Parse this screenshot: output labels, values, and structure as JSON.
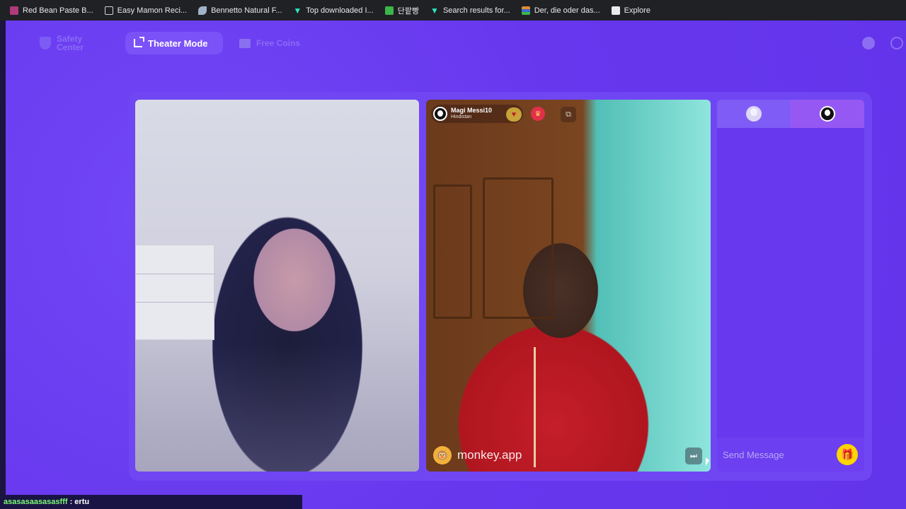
{
  "bookmarks": [
    {
      "label": "Red Bean Paste B...",
      "icon": "bookmark-icon",
      "color": "#b03a7a"
    },
    {
      "label": "Easy Mamon Reci...",
      "icon": "document-icon",
      "color": "#cfd2d6"
    },
    {
      "label": "Bennetto Natural F...",
      "icon": "leaf-icon",
      "color": "#9fb3c8"
    },
    {
      "label": "Top downloaded I...",
      "icon": "vector-v-icon",
      "color": "#2ee6c2"
    },
    {
      "label": "단팥빵",
      "icon": "green-square-icon",
      "color": "#3cb54a"
    },
    {
      "label": "Search results for...",
      "icon": "vector-v-icon",
      "color": "#2ee6c2"
    },
    {
      "label": "Der, die oder das...",
      "icon": "flag-icon",
      "color": "#e0892e"
    },
    {
      "label": "Explore",
      "icon": "explore-icon",
      "color": "#e8eaed"
    }
  ],
  "nav": {
    "safety_label": "Safety Center",
    "theater_label": "Theater Mode",
    "coins_label": "Free Coins"
  },
  "peer": {
    "name": "Magi Messi10",
    "country": "Hindistan"
  },
  "watermark": "monkey.app",
  "chat": {
    "placeholder": "Send Message"
  },
  "status": {
    "user": "asasasaasasasfff",
    "message": " : ertu"
  },
  "colors": {
    "background": "#6a3cf0",
    "stage": "#7046f3",
    "gift": "#ffd400",
    "theater_active": "#7b52f7"
  }
}
